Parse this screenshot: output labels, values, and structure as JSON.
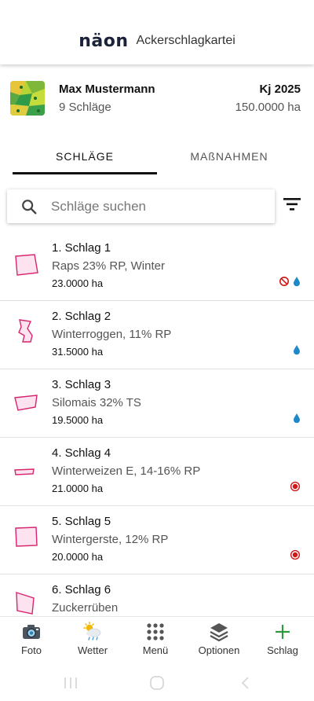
{
  "header": {
    "brand": "näon",
    "title": "Ackerschlagkartei"
  },
  "farm": {
    "name": "Max Mustermann",
    "field_count": "9 Schläge",
    "year": "Kj 2025",
    "total_area": "150.0000 ha"
  },
  "tabs": [
    {
      "label": "SCHLÄGE",
      "active": true
    },
    {
      "label": "MAßNAHMEN",
      "active": false
    }
  ],
  "search": {
    "placeholder": "Schläge suchen",
    "value": ""
  },
  "fields": [
    {
      "title": "1. Schlag 1",
      "crop": "Raps 23% RP, Winter",
      "area": "23.0000 ha",
      "icons": [
        "no-entry-icon",
        "water-drop-icon"
      ]
    },
    {
      "title": "2. Schlag 2",
      "crop": "Winterroggen, 11% RP",
      "area": "31.5000 ha",
      "icons": [
        "water-drop-icon"
      ]
    },
    {
      "title": "3. Schlag 3",
      "crop": "Silomais 32% TS",
      "area": "19.5000 ha",
      "icons": [
        "water-drop-icon"
      ]
    },
    {
      "title": "4. Schlag 4",
      "crop": "Winterweizen E, 14-16% RP",
      "area": "21.0000 ha",
      "icons": [
        "record-dot-icon"
      ]
    },
    {
      "title": "5. Schlag 5",
      "crop": "Wintergerste, 12% RP",
      "area": "20.0000 ha",
      "icons": [
        "record-dot-icon"
      ]
    },
    {
      "title": "6. Schlag 6",
      "crop": "Zuckerrüben",
      "area": "",
      "icons": []
    }
  ],
  "bottom_nav": [
    {
      "label": "Foto",
      "icon": "camera-icon"
    },
    {
      "label": "Wetter",
      "icon": "weather-icon"
    },
    {
      "label": "Menü",
      "icon": "grid-icon"
    },
    {
      "label": "Optionen",
      "icon": "layers-icon"
    },
    {
      "label": "Schlag",
      "icon": "plus-icon"
    }
  ],
  "colors": {
    "field_outline": "#d6246e",
    "field_fill": "#fde3ef",
    "water": "#1e88c8",
    "record": "#d01818",
    "accent_green": "#2e9a3e",
    "brand": "#1a2238"
  }
}
